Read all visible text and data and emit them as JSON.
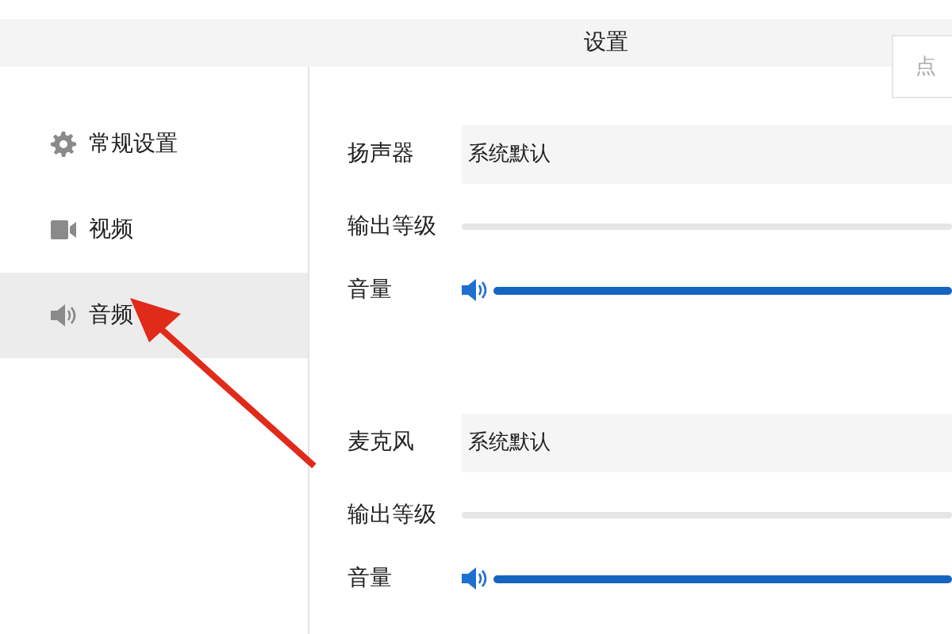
{
  "window": {
    "title": "设置"
  },
  "search": {
    "placeholder": "点"
  },
  "sidebar": {
    "items": [
      {
        "label": "常规设置",
        "kind": "gear",
        "selected": false
      },
      {
        "label": "视频",
        "kind": "camera",
        "selected": false
      },
      {
        "label": "音频",
        "kind": "speaker",
        "selected": true
      }
    ]
  },
  "devices": [
    {
      "label": "扬声器",
      "value": "系统默认",
      "output": {
        "label": "输出等级",
        "level": 0
      },
      "volume": {
        "label": "音量",
        "level": 1
      }
    },
    {
      "label": "麦克风",
      "value": "系统默认",
      "output": {
        "label": "输出等级",
        "level": 0
      },
      "volume": {
        "label": "音量",
        "level": 1
      }
    }
  ]
}
